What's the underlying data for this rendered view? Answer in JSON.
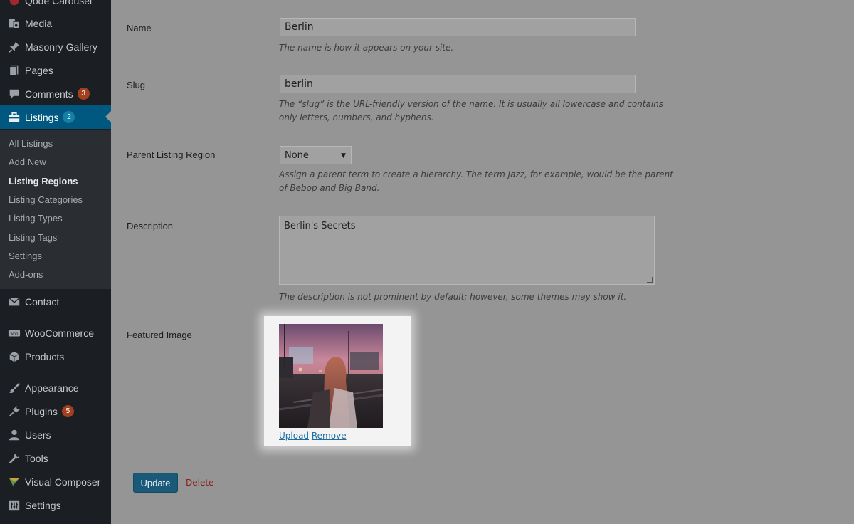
{
  "sidebar": {
    "top_partial": "Qode Carousel",
    "items_above": [
      {
        "label": "Media",
        "icon": "media-icon"
      },
      {
        "label": "Masonry Gallery",
        "icon": "pin-icon"
      },
      {
        "label": "Pages",
        "icon": "pages-icon"
      },
      {
        "label": "Comments",
        "icon": "comments-icon",
        "badge": "3"
      },
      {
        "label": "Listings",
        "icon": "briefcase-icon",
        "badge": "2",
        "active": true
      }
    ],
    "submenu": [
      {
        "label": "All Listings"
      },
      {
        "label": "Add New"
      },
      {
        "label": "Listing Regions",
        "current": true
      },
      {
        "label": "Listing Categories"
      },
      {
        "label": "Listing Types"
      },
      {
        "label": "Listing Tags"
      },
      {
        "label": "Settings"
      },
      {
        "label": "Add-ons"
      }
    ],
    "items_below": [
      {
        "label": "Contact",
        "icon": "mail-icon"
      },
      {
        "label": "WooCommerce",
        "icon": "woo-icon"
      },
      {
        "label": "Products",
        "icon": "box-icon"
      },
      {
        "label": "Appearance",
        "icon": "brush-icon"
      },
      {
        "label": "Plugins",
        "icon": "plug-icon",
        "badge": "5"
      },
      {
        "label": "Users",
        "icon": "user-icon"
      },
      {
        "label": "Tools",
        "icon": "wrench-icon"
      },
      {
        "label": "Visual Composer",
        "icon": "vc-icon"
      },
      {
        "label": "Settings",
        "icon": "settings-icon"
      }
    ]
  },
  "form": {
    "name": {
      "label": "Name",
      "value": "Berlin",
      "hint": "The name is how it appears on your site."
    },
    "slug": {
      "label": "Slug",
      "value": "berlin",
      "hint": "The “slug” is the URL-friendly version of the name. It is usually all lowercase and contains only letters, numbers, and hyphens."
    },
    "parent": {
      "label": "Parent Listing Region",
      "value": "None",
      "hint": "Assign a parent term to create a hierarchy. The term Jazz, for example, would be the parent of Bebop and Big Band."
    },
    "description": {
      "label": "Description",
      "value": "Berlin's Secrets",
      "hint": "The description is not prominent by default; however, some themes may show it."
    },
    "featured_image": {
      "label": "Featured Image",
      "upload": "Upload",
      "remove": "Remove"
    }
  },
  "actions": {
    "update": "Update",
    "delete": "Delete"
  },
  "colors": {
    "sidebar_bg": "#1b1e22",
    "active_bg": "#00577f",
    "badge_red": "#a1401e",
    "badge_blue": "#1480a6",
    "link": "#1d6e9e",
    "delete": "#8a1f13"
  }
}
